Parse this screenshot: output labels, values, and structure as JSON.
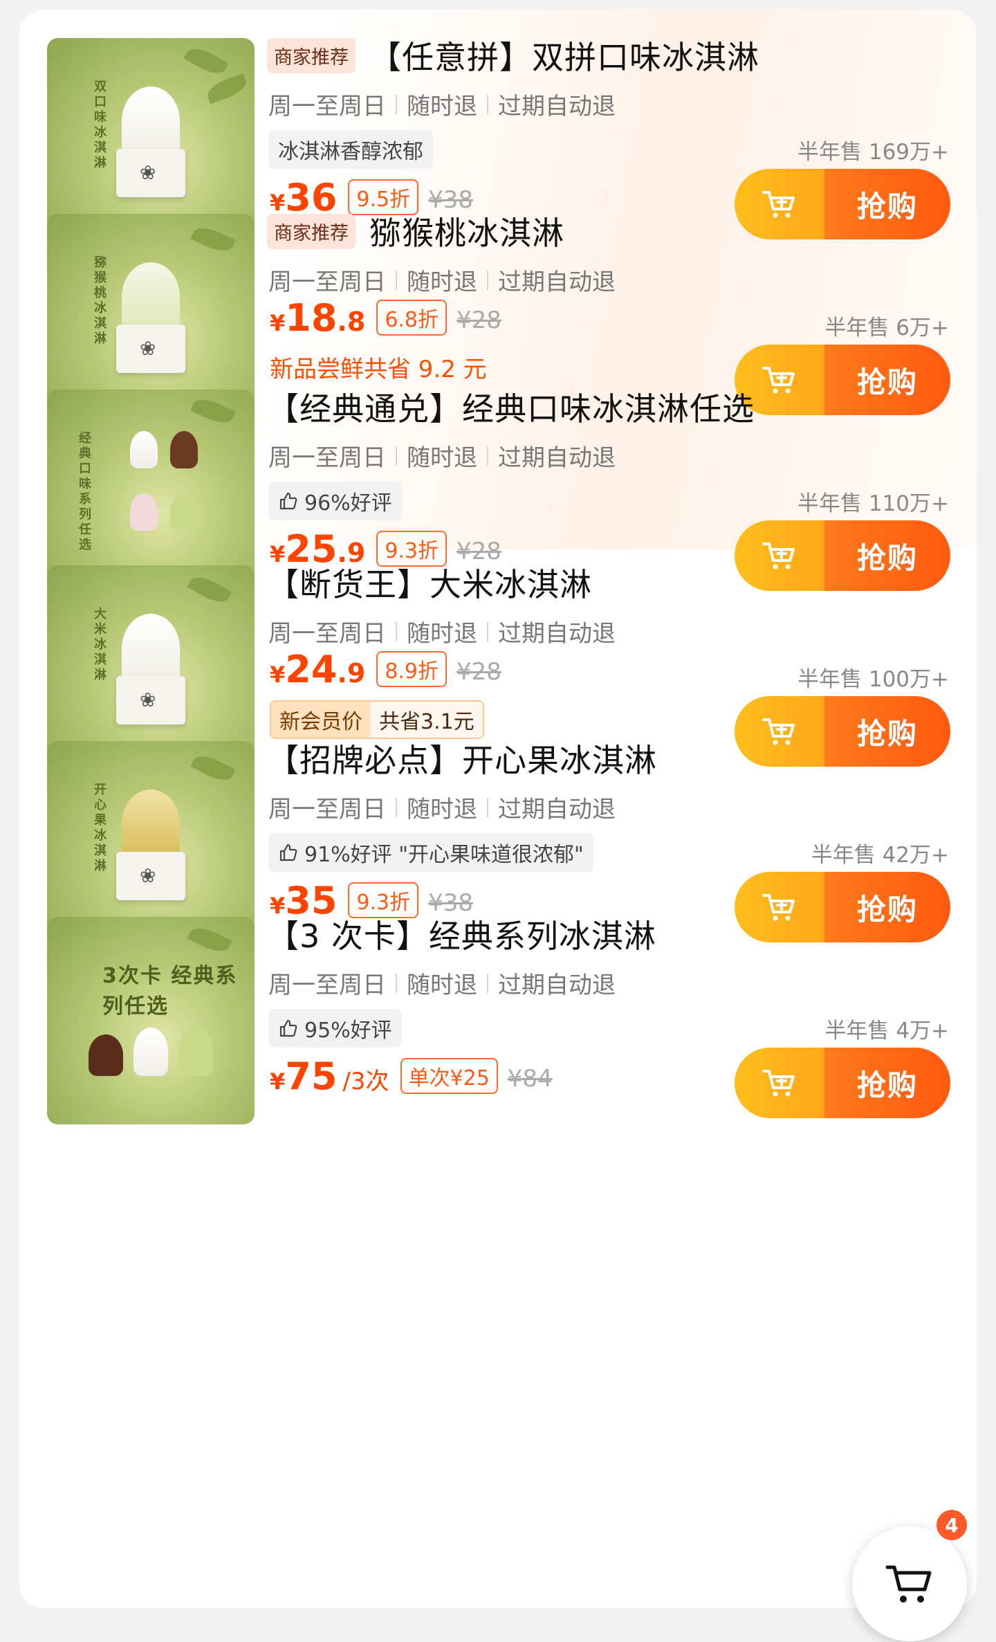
{
  "buy_label": "抢购",
  "cart_badge_count": "4",
  "colors": {
    "price": "#ff4400",
    "buy_start": "#ffbe1c",
    "buy_end": "#ff5a10",
    "merchant_tag_bg": "#fde4d8"
  },
  "products": [
    {
      "merchant_tag": "商家推荐",
      "title": "【任意拼】双拼口味冰淇淋",
      "features": [
        "周一至周日",
        "随时退",
        "过期自动退"
      ],
      "pill": "冰淇淋香醇浓郁",
      "price_yen": "¥",
      "price_int": "36",
      "price_dec": "",
      "discount": "9.5折",
      "original_price": "¥38",
      "sold": "半年售 169万+",
      "thumb_text": "双口味冰淇淋"
    },
    {
      "merchant_tag": "商家推荐",
      "title": "猕猴桃冰淇淋",
      "features": [
        "周一至周日",
        "随时退",
        "过期自动退"
      ],
      "price_yen": "¥",
      "price_int": "18",
      "price_dec": ".8",
      "discount": "6.8折",
      "original_price": "¥28",
      "savings": "新品尝鲜共省 9.2 元",
      "sold": "半年售 6万+",
      "thumb_text": "猕猴桃冰淇淋"
    },
    {
      "title": "【经典通兑】经典口味冰淇淋任选",
      "features": [
        "周一至周日",
        "随时退",
        "过期自动退"
      ],
      "pill": "96%好评",
      "price_yen": "¥",
      "price_int": "25",
      "price_dec": ".9",
      "discount": "9.3折",
      "original_price": "¥28",
      "sold": "半年售 110万+",
      "thumb_text": "经典口味系列任选"
    },
    {
      "title": "【断货王】大米冰淇淋",
      "features": [
        "周一至周日",
        "随时退",
        "过期自动退"
      ],
      "price_yen": "¥",
      "price_int": "24",
      "price_dec": ".9",
      "discount": "8.9折",
      "original_price": "¥28",
      "member_label": "新会员价",
      "member_save": "共省3.1元",
      "sold": "半年售 100万+",
      "thumb_text": "大米冰淇淋"
    },
    {
      "title": "【招牌必点】开心果冰淇淋",
      "features": [
        "周一至周日",
        "随时退",
        "过期自动退"
      ],
      "pill": "91%好评 \"开心果味道很浓郁\"",
      "price_yen": "¥",
      "price_int": "35",
      "price_dec": "",
      "discount": "9.3折",
      "original_price": "¥38",
      "sold": "半年售 42万+",
      "thumb_text": "开心果冰淇淋"
    },
    {
      "title": "【3 次卡】经典系列冰淇淋",
      "features": [
        "周一至周日",
        "随时退",
        "过期自动退"
      ],
      "pill": "95%好评",
      "price_yen": "¥",
      "price_int": "75",
      "price_dec": "",
      "price_per": "/3次",
      "discount": "单次¥25",
      "original_price": "¥84",
      "sold": "半年售 4万+",
      "thumb_text": "3次卡 经典系列任选"
    }
  ]
}
